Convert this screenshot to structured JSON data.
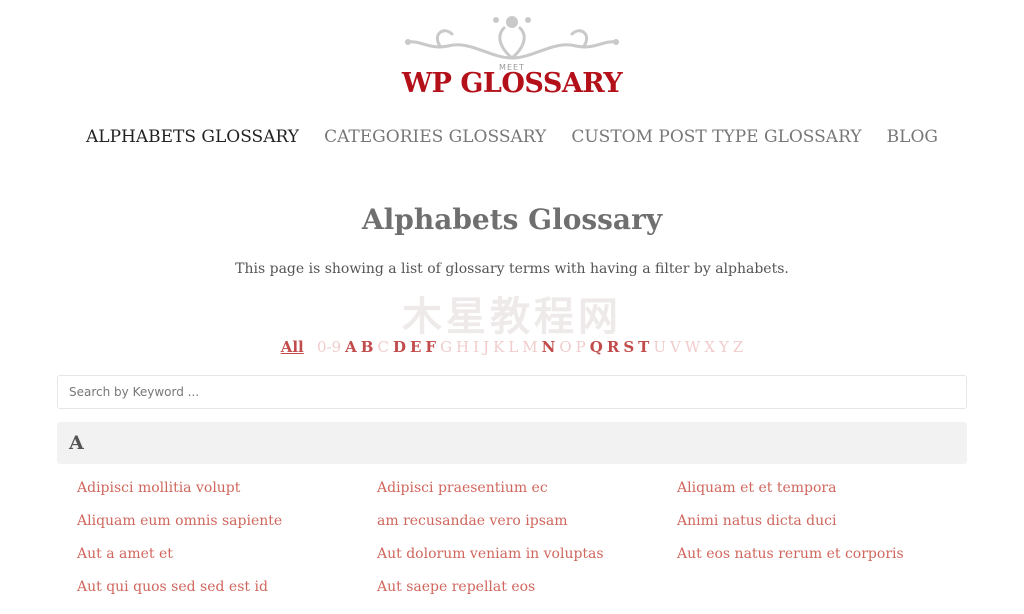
{
  "logo": {
    "small_text": "MEET",
    "title": "WP GLOSSARY"
  },
  "nav": [
    {
      "label": "ALPHABETS GLOSSARY",
      "active": true
    },
    {
      "label": "CATEGORIES GLOSSARY",
      "active": false
    },
    {
      "label": "CUSTOM POST TYPE GLOSSARY",
      "active": false
    },
    {
      "label": "BLOG",
      "active": false
    }
  ],
  "page": {
    "title": "Alphabets Glossary",
    "description": "This page is showing a list of glossary terms with having a filter by alphabets.",
    "watermark": "木星教程网"
  },
  "alphabet_filter": {
    "all_label": "All",
    "letters": [
      {
        "label": "0-9",
        "active": false
      },
      {
        "label": "A",
        "active": true
      },
      {
        "label": "B",
        "active": true
      },
      {
        "label": "C",
        "active": false
      },
      {
        "label": "D",
        "active": true
      },
      {
        "label": "E",
        "active": true
      },
      {
        "label": "F",
        "active": true
      },
      {
        "label": "G",
        "active": false
      },
      {
        "label": "H",
        "active": false
      },
      {
        "label": "I",
        "active": false
      },
      {
        "label": "J",
        "active": false
      },
      {
        "label": "K",
        "active": false
      },
      {
        "label": "L",
        "active": false
      },
      {
        "label": "M",
        "active": false
      },
      {
        "label": "N",
        "active": true
      },
      {
        "label": "O",
        "active": false
      },
      {
        "label": "P",
        "active": false
      },
      {
        "label": "Q",
        "active": true
      },
      {
        "label": "R",
        "active": true
      },
      {
        "label": "S",
        "active": true
      },
      {
        "label": "T",
        "active": true
      },
      {
        "label": "U",
        "active": false
      },
      {
        "label": "V",
        "active": false
      },
      {
        "label": "W",
        "active": false
      },
      {
        "label": "X",
        "active": false
      },
      {
        "label": "Y",
        "active": false
      },
      {
        "label": "Z",
        "active": false
      }
    ]
  },
  "search": {
    "placeholder": "Search by Keyword ...",
    "value": ""
  },
  "section": {
    "letter": "A",
    "terms": [
      "Adipisci mollitia volupt",
      "Adipisci praesentium ec",
      "Aliquam et et tempora",
      "Aliquam eum omnis sapiente",
      "am recusandae vero ipsam",
      "Animi natus dicta duci",
      "Aut a amet et",
      "Aut dolorum veniam in voluptas",
      "Aut eos natus rerum et corporis",
      "Aut qui quos sed sed est id",
      "Aut saepe repellat eos"
    ]
  },
  "colors": {
    "brand_red": "#b3101a",
    "link": "#d0675e",
    "letter_active": "#c24c4c",
    "letter_inactive": "#f0cccc"
  }
}
